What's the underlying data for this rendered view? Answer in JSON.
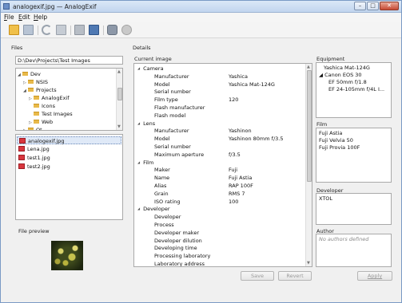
{
  "window": {
    "title": "analogexif.jpg — AnalogExif"
  },
  "menu": [
    {
      "label": "File",
      "accel": "F",
      "rest": "ile"
    },
    {
      "label": "Edit",
      "accel": "E",
      "rest": "dit"
    },
    {
      "label": "Help",
      "accel": "H",
      "rest": "elp"
    }
  ],
  "toolbar_icons": [
    "open-folder-icon",
    "save-icon",
    "revert-icon",
    "copy-icon",
    "paste-icon",
    "export-icon",
    "gear-icon",
    "settings-icon"
  ],
  "files": {
    "label": "Files",
    "path": "D:\\Dev\\Projects\\Test Images",
    "tree": [
      {
        "name": "Dev",
        "level": 1,
        "expander": "◢"
      },
      {
        "name": "NSIS",
        "level": 2,
        "expander": "▷"
      },
      {
        "name": "Projects",
        "level": 2,
        "expander": "◢"
      },
      {
        "name": "AnalogExif",
        "level": 3,
        "expander": "▷"
      },
      {
        "name": "Icons",
        "level": 3,
        "expander": ""
      },
      {
        "name": "Test Images",
        "level": 3,
        "expander": ""
      },
      {
        "name": "Web",
        "level": 3,
        "expander": "▷"
      },
      {
        "name": "Qt",
        "level": 2,
        "expander": "▷"
      }
    ],
    "list": [
      "analogexif.jpg",
      "Lena.jpg",
      "test1.jpg",
      "test2.jpg"
    ],
    "selected_index": 0
  },
  "preview": {
    "label": "File preview"
  },
  "details": {
    "label": "Details",
    "current_image_label": "Current image",
    "rows": [
      {
        "type": "cat",
        "label": "Camera",
        "value": ""
      },
      {
        "type": "prop",
        "label": "Manufacturer",
        "value": "Yashica"
      },
      {
        "type": "prop",
        "label": "Model",
        "value": "Yashica Mat-124G"
      },
      {
        "type": "prop",
        "label": "Serial number",
        "value": ""
      },
      {
        "type": "prop",
        "label": "Film type",
        "value": "120"
      },
      {
        "type": "prop",
        "label": "Flash manufacturer",
        "value": ""
      },
      {
        "type": "prop",
        "label": "Flash model",
        "value": ""
      },
      {
        "type": "cat",
        "label": "Lens",
        "value": ""
      },
      {
        "type": "prop",
        "label": "Manufacturer",
        "value": "Yashinon"
      },
      {
        "type": "prop",
        "label": "Model",
        "value": "Yashinon 80mm f/3.5"
      },
      {
        "type": "prop",
        "label": "Serial number",
        "value": ""
      },
      {
        "type": "prop",
        "label": "Maximum aperture",
        "value": "f/3.5"
      },
      {
        "type": "cat",
        "label": "Film",
        "value": ""
      },
      {
        "type": "prop",
        "label": "Maker",
        "value": "Fuji"
      },
      {
        "type": "prop",
        "label": "Name",
        "value": "Fuji Astia"
      },
      {
        "type": "prop",
        "label": "Alias",
        "value": "RAP 100F"
      },
      {
        "type": "prop",
        "label": "Grain",
        "value": "RMS 7"
      },
      {
        "type": "prop",
        "label": "ISO rating",
        "value": "100"
      },
      {
        "type": "cat",
        "label": "Developer",
        "value": ""
      },
      {
        "type": "prop",
        "label": "Developer",
        "value": ""
      },
      {
        "type": "prop",
        "label": "Process",
        "value": ""
      },
      {
        "type": "prop",
        "label": "Developer maker",
        "value": ""
      },
      {
        "type": "prop",
        "label": "Developer dilution",
        "value": ""
      },
      {
        "type": "prop",
        "label": "Developing time",
        "value": ""
      },
      {
        "type": "prop",
        "label": "Processing laboratory",
        "value": ""
      },
      {
        "type": "prop",
        "label": "Laboratory address",
        "value": ""
      }
    ],
    "save_label": "Save",
    "revert_label": "Revert"
  },
  "equipment": {
    "label": "Equipment",
    "items": [
      {
        "text": "Yashica Mat-124G",
        "indent": 1
      },
      {
        "text": "◢ Canon EOS 30",
        "indent": 0
      },
      {
        "text": "EF 50mm f/1.8",
        "indent": 2
      },
      {
        "text": "EF 24-105mm f/4L I...",
        "indent": 2
      }
    ]
  },
  "film": {
    "label": "Film",
    "items": [
      "Fuji Astia",
      "Fuji Velvia 50",
      "Fuji Provia 100F"
    ]
  },
  "developer": {
    "label": "Developer",
    "items": [
      "XTOL"
    ]
  },
  "author": {
    "label": "Author",
    "placeholder": "No authors defined"
  },
  "apply_label": "Apply"
}
